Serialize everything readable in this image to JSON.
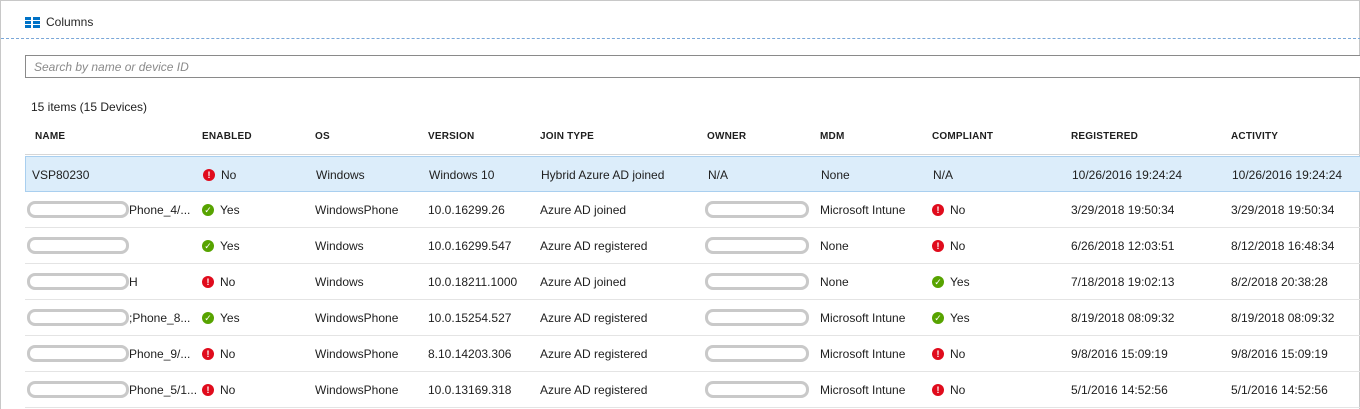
{
  "toolbar": {
    "columns_label": "Columns"
  },
  "search": {
    "placeholder": "Search by name or device ID"
  },
  "summary": {
    "count_text": "15 items (15 Devices)"
  },
  "table": {
    "headers": [
      "NAME",
      "ENABLED",
      "OS",
      "VERSION",
      "JOIN TYPE",
      "OWNER",
      "MDM",
      "COMPLIANT",
      "REGISTERED",
      "ACTIVITY"
    ],
    "rows": [
      {
        "name": "VSP80230",
        "name_redacted": false,
        "enabled": "No",
        "enabled_status": "no",
        "os": "Windows",
        "version": "Windows 10",
        "join_type": "Hybrid Azure AD joined",
        "owner": "N/A",
        "owner_redacted": false,
        "mdm": "None",
        "compliant": "N/A",
        "compliant_status": "none",
        "registered": "10/26/2016 19:24:24",
        "activity": "10/26/2016 19:24:24",
        "selected": true
      },
      {
        "name": "Phone_4/...",
        "name_redacted": true,
        "enabled": "Yes",
        "enabled_status": "yes",
        "os": "WindowsPhone",
        "version": "10.0.16299.26",
        "join_type": "Azure AD joined",
        "owner": "",
        "owner_redacted": true,
        "mdm": "Microsoft Intune",
        "compliant": "No",
        "compliant_status": "no",
        "registered": "3/29/2018 19:50:34",
        "activity": "3/29/2018 19:50:34",
        "selected": false
      },
      {
        "name": "",
        "name_redacted": true,
        "enabled": "Yes",
        "enabled_status": "yes",
        "os": "Windows",
        "version": "10.0.16299.547",
        "join_type": "Azure AD registered",
        "owner": "",
        "owner_redacted": true,
        "mdm": "None",
        "compliant": "No",
        "compliant_status": "no",
        "registered": "6/26/2018 12:03:51",
        "activity": "8/12/2018 16:48:34",
        "selected": false
      },
      {
        "name": "H",
        "name_redacted": true,
        "enabled": "No",
        "enabled_status": "no",
        "os": "Windows",
        "version": "10.0.18211.1000",
        "join_type": "Azure AD joined",
        "owner": "",
        "owner_redacted": true,
        "mdm": "None",
        "compliant": "Yes",
        "compliant_status": "yes",
        "registered": "7/18/2018 19:02:13",
        "activity": "8/2/2018 20:38:28",
        "selected": false
      },
      {
        "name": ";Phone_8...",
        "name_redacted": true,
        "enabled": "Yes",
        "enabled_status": "yes",
        "os": "WindowsPhone",
        "version": "10.0.15254.527",
        "join_type": "Azure AD registered",
        "owner": "",
        "owner_redacted": true,
        "mdm": "Microsoft Intune",
        "compliant": "Yes",
        "compliant_status": "yes",
        "registered": "8/19/2018 08:09:32",
        "activity": "8/19/2018 08:09:32",
        "selected": false
      },
      {
        "name": "Phone_9/...",
        "name_redacted": true,
        "enabled": "No",
        "enabled_status": "no",
        "os": "WindowsPhone",
        "version": "8.10.14203.306",
        "join_type": "Azure AD registered",
        "owner": "",
        "owner_redacted": true,
        "mdm": "Microsoft Intune",
        "compliant": "No",
        "compliant_status": "no",
        "registered": "9/8/2016 15:09:19",
        "activity": "9/8/2016 15:09:19",
        "selected": false
      },
      {
        "name": "Phone_5/1...",
        "name_redacted": true,
        "enabled": "No",
        "enabled_status": "no",
        "os": "WindowsPhone",
        "version": "10.0.13169.318",
        "join_type": "Azure AD registered",
        "owner": "",
        "owner_redacted": true,
        "mdm": "Microsoft Intune",
        "compliant": "No",
        "compliant_status": "no",
        "registered": "5/1/2016 14:52:56",
        "activity": "5/1/2016 14:52:56",
        "selected": false
      }
    ]
  },
  "colors": {
    "accent": "#0072c6",
    "status_no": "#e00b1c",
    "status_yes": "#57a300",
    "selected_row": "#dcedfa"
  },
  "icons": {
    "columns": "columns-grid-icon",
    "status_no": "exclamation-icon",
    "status_yes": "checkmark-icon"
  }
}
